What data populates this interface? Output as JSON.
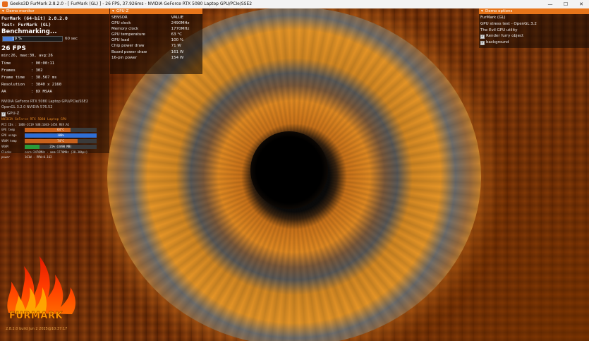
{
  "window": {
    "title": "Geeks3D FurMark 2.8.2.0 - [ FurMark (GL) ] - 26 FPS, 37.926ms - NVIDIA GeForce RTX 5080 Laptop GPU/PCIe/SSE2",
    "controls": [
      "—",
      "☐",
      "✕"
    ]
  },
  "demo_monitor": {
    "header": "Demo monitor",
    "app_name": "FurMark (64-bit) 2.8.2.0",
    "test": "Test: FurMark (GL)",
    "status": "Benchmarking...",
    "progress": {
      "percent_label": "19 %",
      "fraction": 0.19,
      "end_label": "60 sec"
    },
    "fps": "26 FPS",
    "stats": "min:26, max:30, avg:26",
    "rows": [
      {
        "key": "Time",
        "value": ": 00:00:11"
      },
      {
        "key": "Frames",
        "value": ": 302"
      },
      {
        "key": "Frame time",
        "value": ": 38.567 ms"
      },
      {
        "key": "Resolution",
        "value": ": 3840 x 2160"
      },
      {
        "key": "AA",
        "value": ": 8X MSAA"
      }
    ],
    "gpu_name": "NVIDIA GeForce RTX 5080 Laptop GPU/PCIe/SSE2",
    "opengl": "OpenGL 3.2.0 NVIDIA 576.52"
  },
  "gpuz_mini": {
    "title": "GPU-Z",
    "gpu_name": "NVIDIA GeForce RTX 5080 Laptop GPU",
    "pci": "PCI IDs     : 10DE-2C19 SUB:1043-1454 REV:A1",
    "bars": [
      {
        "label": "GPU temp",
        "value": "64°C",
        "fraction": 0.64,
        "color": "#c8611c"
      },
      {
        "label": "GPU usage",
        "value": "100%",
        "fraction": 1.0,
        "color": "#2f6fd6"
      },
      {
        "label": "VRAM temp",
        "value": "74°C",
        "fraction": 0.74,
        "color": "#c8611c"
      },
      {
        "label": "VRAM",
        "value": "21% (3490 MB)",
        "fraction": 0.21,
        "color": "#2a9a3a"
      }
    ],
    "clocks": {
      "label": "Clocks",
      "value": "core:2476MHz - mem:1770MHz (30.30bps)"
    },
    "power": {
      "label": "power",
      "value": "161W - PPW:0.162"
    }
  },
  "gpuz_panel": {
    "header": "GPU-Z",
    "columns": [
      "SENSOR",
      "VALUE"
    ],
    "rows": [
      [
        "GPU clock",
        "2490MHz"
      ],
      [
        "Memory clock",
        "1770MHz"
      ],
      [
        "GPU temperature",
        "63 °C"
      ],
      [
        "GPU load",
        "100 %"
      ],
      [
        "Chip power draw",
        "71 W"
      ],
      [
        "Board power draw",
        "161 W"
      ],
      [
        "16-pin power",
        "154 W"
      ]
    ]
  },
  "demo_options": {
    "header": "Demo options",
    "lines": [
      "FurMark (GL)",
      "GPU stress test - OpenGL 3.2",
      "The Evil GPU utility"
    ],
    "checkboxes": [
      {
        "label": "Render furry object",
        "checked": true
      },
      {
        "label": "background",
        "checked": true
      }
    ]
  },
  "logo": {
    "text": "FURMARK",
    "build": "2.8.2.0 build Jun 2 2025@10:37:17"
  },
  "colors": {
    "accent": "#e7751a",
    "progress_fill": "#4a7fd8"
  }
}
